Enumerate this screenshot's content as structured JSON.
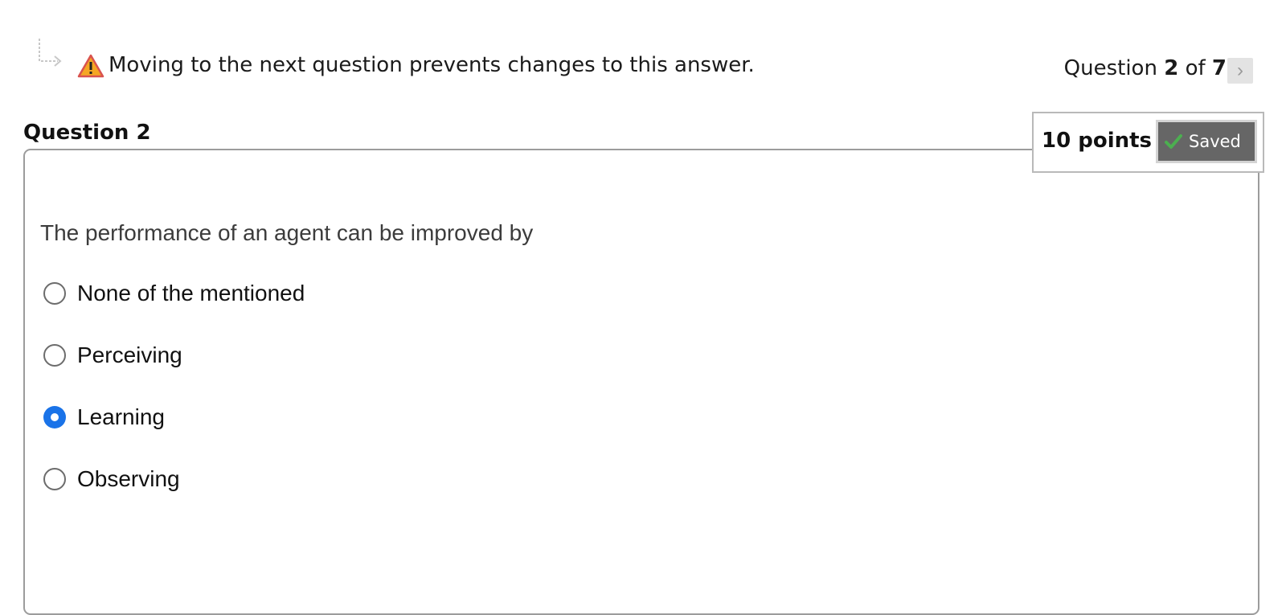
{
  "notice": {
    "icon": "warning-icon",
    "text": "Moving to the next question prevents changes to this answer."
  },
  "counter": {
    "prefix": "Question",
    "current": "2",
    "of_word": "of",
    "total": "7",
    "next_icon": "chevron-right-icon",
    "next_glyph": "›"
  },
  "question": {
    "heading": "Question 2",
    "points": "10 points",
    "saved_label": "Saved",
    "saved_icon": "check-icon",
    "prompt": "The performance of an agent can be improved by",
    "options": [
      {
        "label": "None of the mentioned",
        "selected": false
      },
      {
        "label": "Perceiving",
        "selected": false
      },
      {
        "label": "Learning",
        "selected": true
      },
      {
        "label": "Observing",
        "selected": false
      }
    ]
  },
  "colors": {
    "accent": "#1a73e8",
    "saved_badge": "#666666",
    "warning": "#f5a623",
    "check": "#4caf50"
  }
}
